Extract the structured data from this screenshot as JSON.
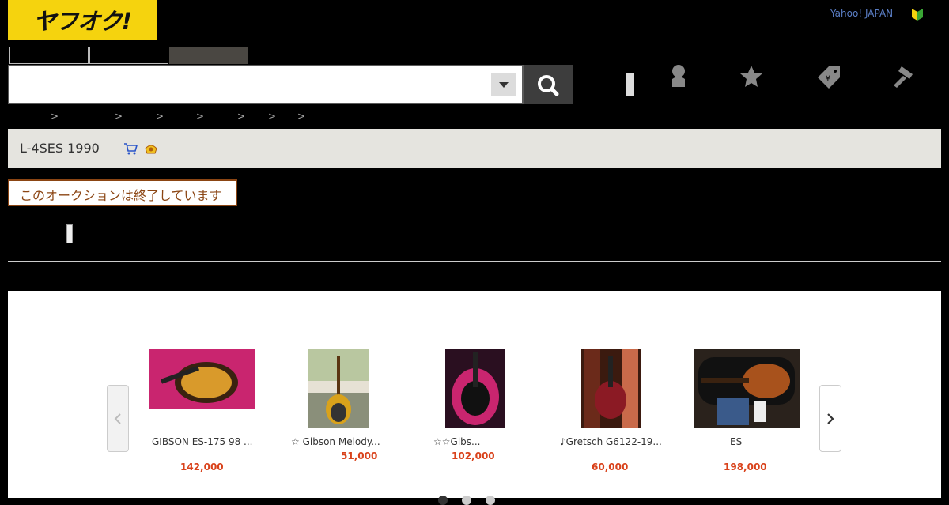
{
  "header": {
    "logo_text": "ヤフオク!",
    "yahoo_link": "Yahoo! JAPAN",
    "tabs": [
      "",
      "",
      ""
    ],
    "search": {
      "placeholder": ""
    }
  },
  "breadcrumb": {
    "separators": [
      ">",
      ">",
      ">",
      ">",
      ">",
      ">",
      ">"
    ]
  },
  "item": {
    "title": "L-4SES 1990"
  },
  "status": {
    "ended_text": "このオークションは終了しています"
  },
  "recommendations": {
    "items": [
      {
        "title": "GIBSON ES-175 98 ...",
        "price": "142,000"
      },
      {
        "title": "☆ Gibson Melody...",
        "price": "51,000"
      },
      {
        "title": "☆☆Gibs...",
        "price": "102,000"
      },
      {
        "title": "♪Gretsch G6122-19...",
        "price": "60,000"
      },
      {
        "title": "ES",
        "price": "198,000"
      }
    ],
    "page_count": 3,
    "current_page": 1
  },
  "colors": {
    "logo_bg": "#f5d30e",
    "price": "#d9421b",
    "ended_border": "#8b4513"
  }
}
